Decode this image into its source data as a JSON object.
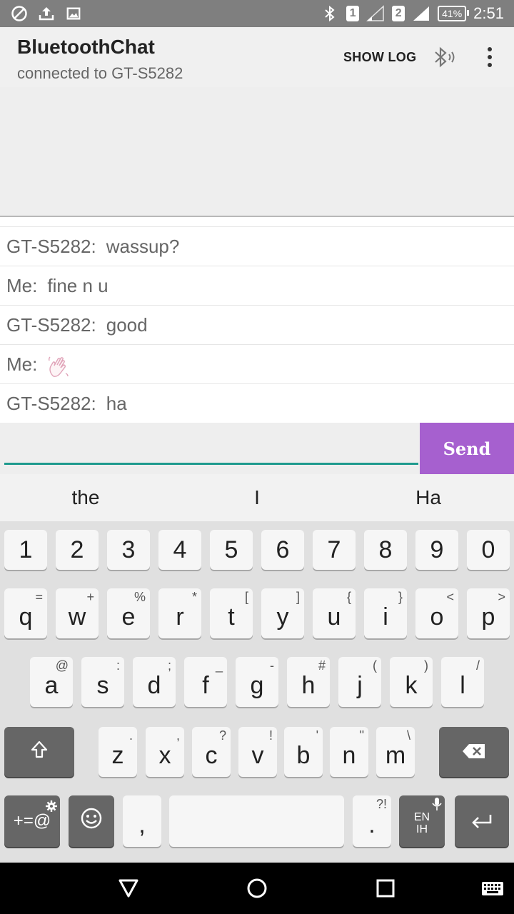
{
  "status_bar": {
    "sim1": "1",
    "sim2": "2",
    "battery": "41%",
    "time": "2:51"
  },
  "app_bar": {
    "title": "BluetoothChat",
    "subtitle": "connected to GT-S5282",
    "show_log": "SHOW LOG"
  },
  "messages": [
    {
      "sender": "GT-S5282:",
      "text": "wassup?"
    },
    {
      "sender": "Me:",
      "text": "fine n u"
    },
    {
      "sender": "GT-S5282:",
      "text": "good"
    },
    {
      "sender": "Me:",
      "text": "",
      "emoji": "waving-hand"
    },
    {
      "sender": "GT-S5282:",
      "text": "ha"
    }
  ],
  "input": {
    "value": "",
    "placeholder": ""
  },
  "send_label": "Send",
  "suggestions": [
    "the",
    "I",
    "Ha"
  ],
  "keyboard": {
    "numbers": [
      "1",
      "2",
      "3",
      "4",
      "5",
      "6",
      "7",
      "8",
      "9",
      "0"
    ],
    "row1": [
      {
        "key": "q",
        "alt": "="
      },
      {
        "key": "w",
        "alt": "+"
      },
      {
        "key": "e",
        "alt": "%"
      },
      {
        "key": "r",
        "alt": "*"
      },
      {
        "key": "t",
        "alt": "["
      },
      {
        "key": "y",
        "alt": "]"
      },
      {
        "key": "u",
        "alt": "{"
      },
      {
        "key": "i",
        "alt": "}"
      },
      {
        "key": "o",
        "alt": "<"
      },
      {
        "key": "p",
        "alt": ">"
      }
    ],
    "row2": [
      {
        "key": "a",
        "alt": "@"
      },
      {
        "key": "s",
        "alt": ":"
      },
      {
        "key": "d",
        "alt": ";"
      },
      {
        "key": "f",
        "alt": "_"
      },
      {
        "key": "g",
        "alt": "-"
      },
      {
        "key": "h",
        "alt": "#"
      },
      {
        "key": "j",
        "alt": "("
      },
      {
        "key": "k",
        "alt": ")"
      },
      {
        "key": "l",
        "alt": "/"
      }
    ],
    "row3": [
      {
        "key": "z",
        "alt": "."
      },
      {
        "key": "x",
        "alt": ","
      },
      {
        "key": "c",
        "alt": "?"
      },
      {
        "key": "v",
        "alt": "!"
      },
      {
        "key": "b",
        "alt": "'"
      },
      {
        "key": "n",
        "alt": "\""
      },
      {
        "key": "m",
        "alt": "\\"
      }
    ],
    "symbols_label": "+=@",
    "comma": ",",
    "period": ".",
    "period_alt": "?!",
    "lang_top": "EN",
    "lang_bottom": "IH"
  },
  "colors": {
    "status_bar": "#7f7f7f",
    "accent_input_line": "#1e9a8e",
    "send_button": "#a660cf"
  }
}
